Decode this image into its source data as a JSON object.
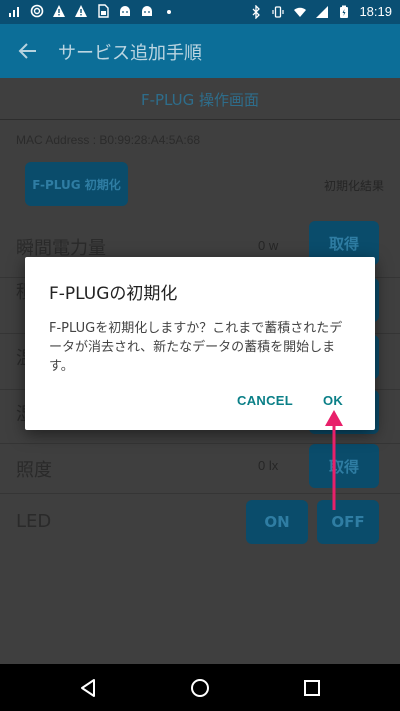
{
  "status_bar": {
    "time": "18:19",
    "icons": [
      "signal-icon",
      "spiral-icon",
      "warning-icon",
      "warning-icon",
      "sim-icon",
      "android-icon",
      "android-icon",
      "dot-icon",
      "bluetooth-icon",
      "vibrate-icon",
      "wifi-icon",
      "cell-icon",
      "battery-icon"
    ]
  },
  "app_bar": {
    "title": "サービス追加手順"
  },
  "page": {
    "subheader": "F-PLUG 操作画面",
    "mac_address": "MAC Address : B0:99:28:A4:5A:68",
    "init_button": "F-PLUG 初期化",
    "init_result_label": "初期化結果",
    "rows": [
      {
        "label": "瞬間電力量",
        "value": "0 w",
        "button": "取得"
      },
      {
        "label": "積",
        "value": "",
        "button": ""
      },
      {
        "label": "温",
        "value": "",
        "button": ""
      },
      {
        "label": "湿",
        "value": "",
        "button": ""
      },
      {
        "label": "照度",
        "value": "0 lx",
        "button": "取得"
      }
    ],
    "led": {
      "label": "LED",
      "on_button": "ON",
      "off_button": "OFF"
    }
  },
  "dialog": {
    "title": "F-PLUGの初期化",
    "message": "F-PLUGを初期化しますか？これまで蓄積されたデータが消去され、新たなデータの蓄積を開始します。",
    "cancel_label": "CANCEL",
    "ok_label": "OK"
  },
  "colors": {
    "status_bar": "#0a4f73",
    "app_bar": "#0c6e98",
    "accent_button": "#0a7f87",
    "annotation_arrow": "#e8206a"
  }
}
